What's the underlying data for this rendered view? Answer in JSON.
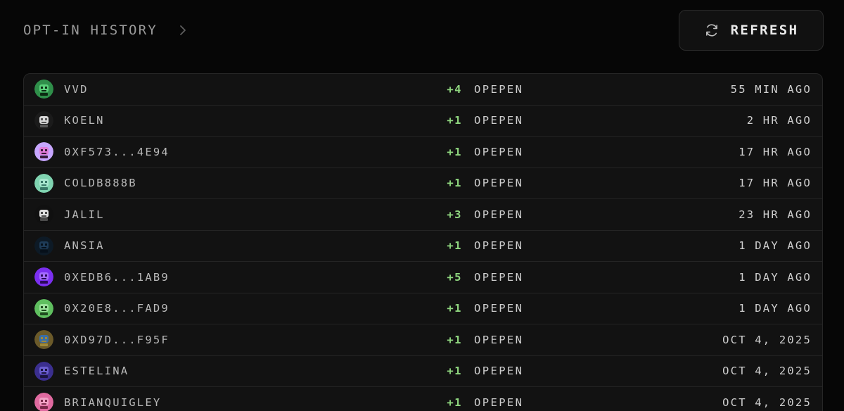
{
  "header": {
    "title": "OPT-IN HISTORY",
    "refresh_label": "REFRESH",
    "chevron_icon": "chevron-right-icon",
    "refresh_icon": "refresh-icon"
  },
  "colors": {
    "background": "#060606",
    "panel": "#121212",
    "amount_positive": "#8fd67f",
    "text": "#cfcfcf",
    "muted": "#9a9a9a"
  },
  "rows": [
    {
      "name": "VVD",
      "amount": "+4",
      "token": "OPEPEN",
      "time": "55 MIN AGO",
      "avatar_colors": [
        "#2f8f4a",
        "#5bd07a",
        "#0b2a12"
      ]
    },
    {
      "name": "KOELN",
      "amount": "+1",
      "token": "OPEPEN",
      "time": "2 HR AGO",
      "avatar_colors": [
        "#1b1b1b",
        "#d9d9d9",
        "#5a5a5a"
      ]
    },
    {
      "name": "0XF573...4E94",
      "amount": "+1",
      "token": "OPEPEN",
      "time": "17 HR AGO",
      "avatar_colors": [
        "#c7a6ff",
        "#e07bd8",
        "#3a1a3a"
      ]
    },
    {
      "name": "COLDB888B",
      "amount": "+1",
      "token": "OPEPEN",
      "time": "17 HR AGO",
      "avatar_colors": [
        "#7fd3b0",
        "#a8e6cf",
        "#3a7a6a"
      ]
    },
    {
      "name": "JALIL",
      "amount": "+3",
      "token": "OPEPEN",
      "time": "23 HR AGO",
      "avatar_colors": [
        "#101010",
        "#e0e0e0",
        "#4a4a4a"
      ]
    },
    {
      "name": "ANSIA",
      "amount": "+1",
      "token": "OPEPEN",
      "time": "1 DAY AGO",
      "avatar_colors": [
        "#0d1a26",
        "#1e3b57",
        "#06101a"
      ]
    },
    {
      "name": "0XEDB6...1AB9",
      "amount": "+5",
      "token": "OPEPEN",
      "time": "1 DAY AGO",
      "avatar_colors": [
        "#7b2ff0",
        "#a36bff",
        "#2b0a5a"
      ]
    },
    {
      "name": "0X20E8...FAD9",
      "amount": "+1",
      "token": "OPEPEN",
      "time": "1 DAY AGO",
      "avatar_colors": [
        "#5fbf5f",
        "#9be29b",
        "#1f4a1f"
      ]
    },
    {
      "name": "0XD97D...F95F",
      "amount": "+1",
      "token": "OPEPEN",
      "time": "OCT 4, 2025",
      "avatar_colors": [
        "#6b5a2a",
        "#3a6ea8",
        "#a08a3a"
      ]
    },
    {
      "name": "ESTELINA",
      "amount": "+1",
      "token": "OPEPEN",
      "time": "OCT 4, 2025",
      "avatar_colors": [
        "#3b2f8f",
        "#6b5fd0",
        "#1a1440"
      ]
    },
    {
      "name": "BRIANQUIGLEY",
      "amount": "+1",
      "token": "OPEPEN",
      "time": "OCT 4, 2025",
      "avatar_colors": [
        "#e06aa0",
        "#f3a3c6",
        "#7a2a4a"
      ]
    }
  ]
}
